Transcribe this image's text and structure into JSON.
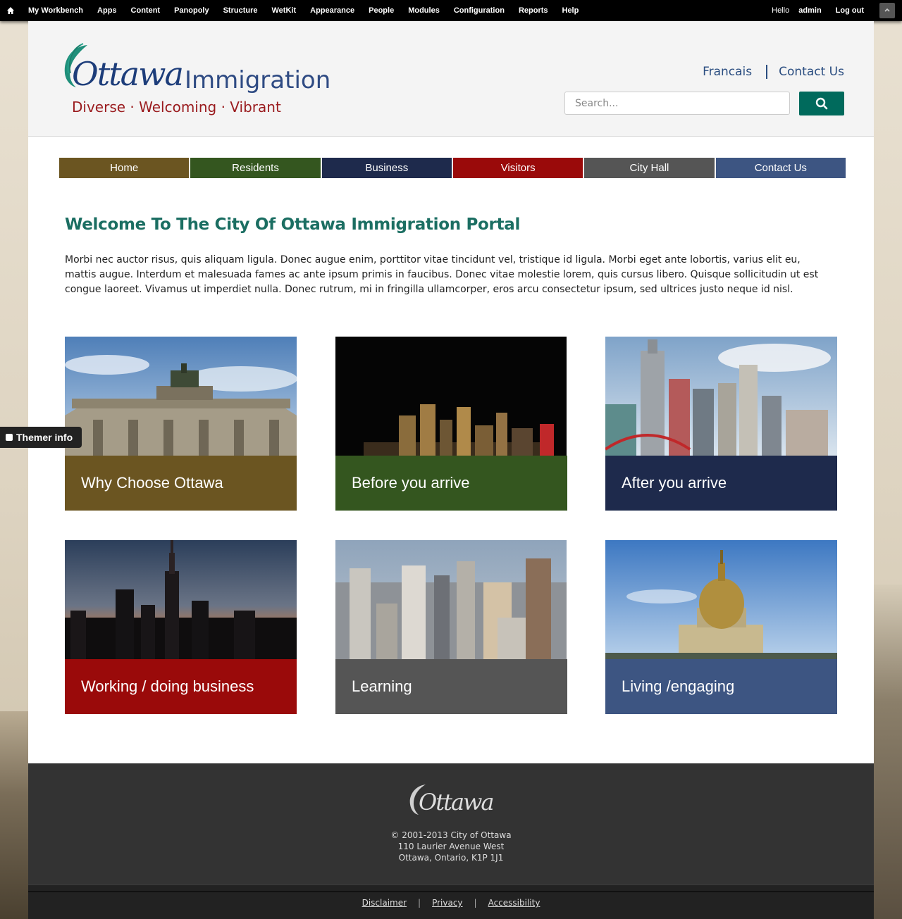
{
  "admin_bar": {
    "menu": [
      "My Workbench",
      "Apps",
      "Content",
      "Panopoly",
      "Structure",
      "WetKit",
      "Appearance",
      "People",
      "Modules",
      "Configuration",
      "Reports",
      "Help"
    ],
    "hello_label": "Hello",
    "user": "admin",
    "logout": "Log out"
  },
  "header": {
    "logo_ottawa": "Ottawa",
    "logo_title": "Immigration",
    "tagline": "Diverse · Welcoming · Vibrant",
    "links": [
      "Francais",
      "Contact Us"
    ],
    "search_placeholder": "Search..."
  },
  "nav": [
    {
      "label": "Home",
      "color": "#6b5521"
    },
    {
      "label": "Residents",
      "color": "#34561f"
    },
    {
      "label": "Business",
      "color": "#1e2a4c"
    },
    {
      "label": "Visitors",
      "color": "#9a0a0a"
    },
    {
      "label": "City Hall",
      "color": "#555555"
    },
    {
      "label": "Contact Us",
      "color": "#3d5582"
    }
  ],
  "main": {
    "title": "Welcome To The City Of Ottawa Immigration Portal",
    "intro": "Morbi nec auctor risus, quis aliquam ligula. Donec augue enim, porttitor vitae tincidunt vel, tristique id ligula. Morbi eget ante lobortis, varius elit eu, mattis augue. Interdum et malesuada fames ac ante ipsum primis in faucibus. Donec vitae molestie lorem, quis cursus libero. Quisque sollicitudin ut est congue laoreet. Vivamus ut imperdiet nulla. Donec rutrum, mi in fringilla ullamcorper, eros arcu consectetur ipsum, sed ultrices justo neque id nisl."
  },
  "tiles": [
    {
      "label": "Why Choose Ottawa",
      "color": "#6b5521",
      "image": "monument-gate"
    },
    {
      "label": "Before you arrive",
      "color": "#34561f",
      "image": "night-skyline"
    },
    {
      "label": "After you arrive",
      "color": "#1e2a4c",
      "image": "towers-daytime"
    },
    {
      "label": "Working / doing business",
      "color": "#9a0a0a",
      "image": "dusk-skyline"
    },
    {
      "label": "Learning",
      "color": "#555555",
      "image": "city-aerial"
    },
    {
      "label": "Living /engaging",
      "color": "#3d5582",
      "image": "domed-building"
    }
  ],
  "themer": "Themer info",
  "footer": {
    "logo": "Ottawa",
    "address": [
      "© 2001-2013 City of Ottawa",
      "110 Laurier Avenue West",
      "Ottawa, Ontario, K1P 1J1"
    ],
    "links": [
      "Disclaimer",
      "Privacy",
      "Accessibility"
    ]
  }
}
